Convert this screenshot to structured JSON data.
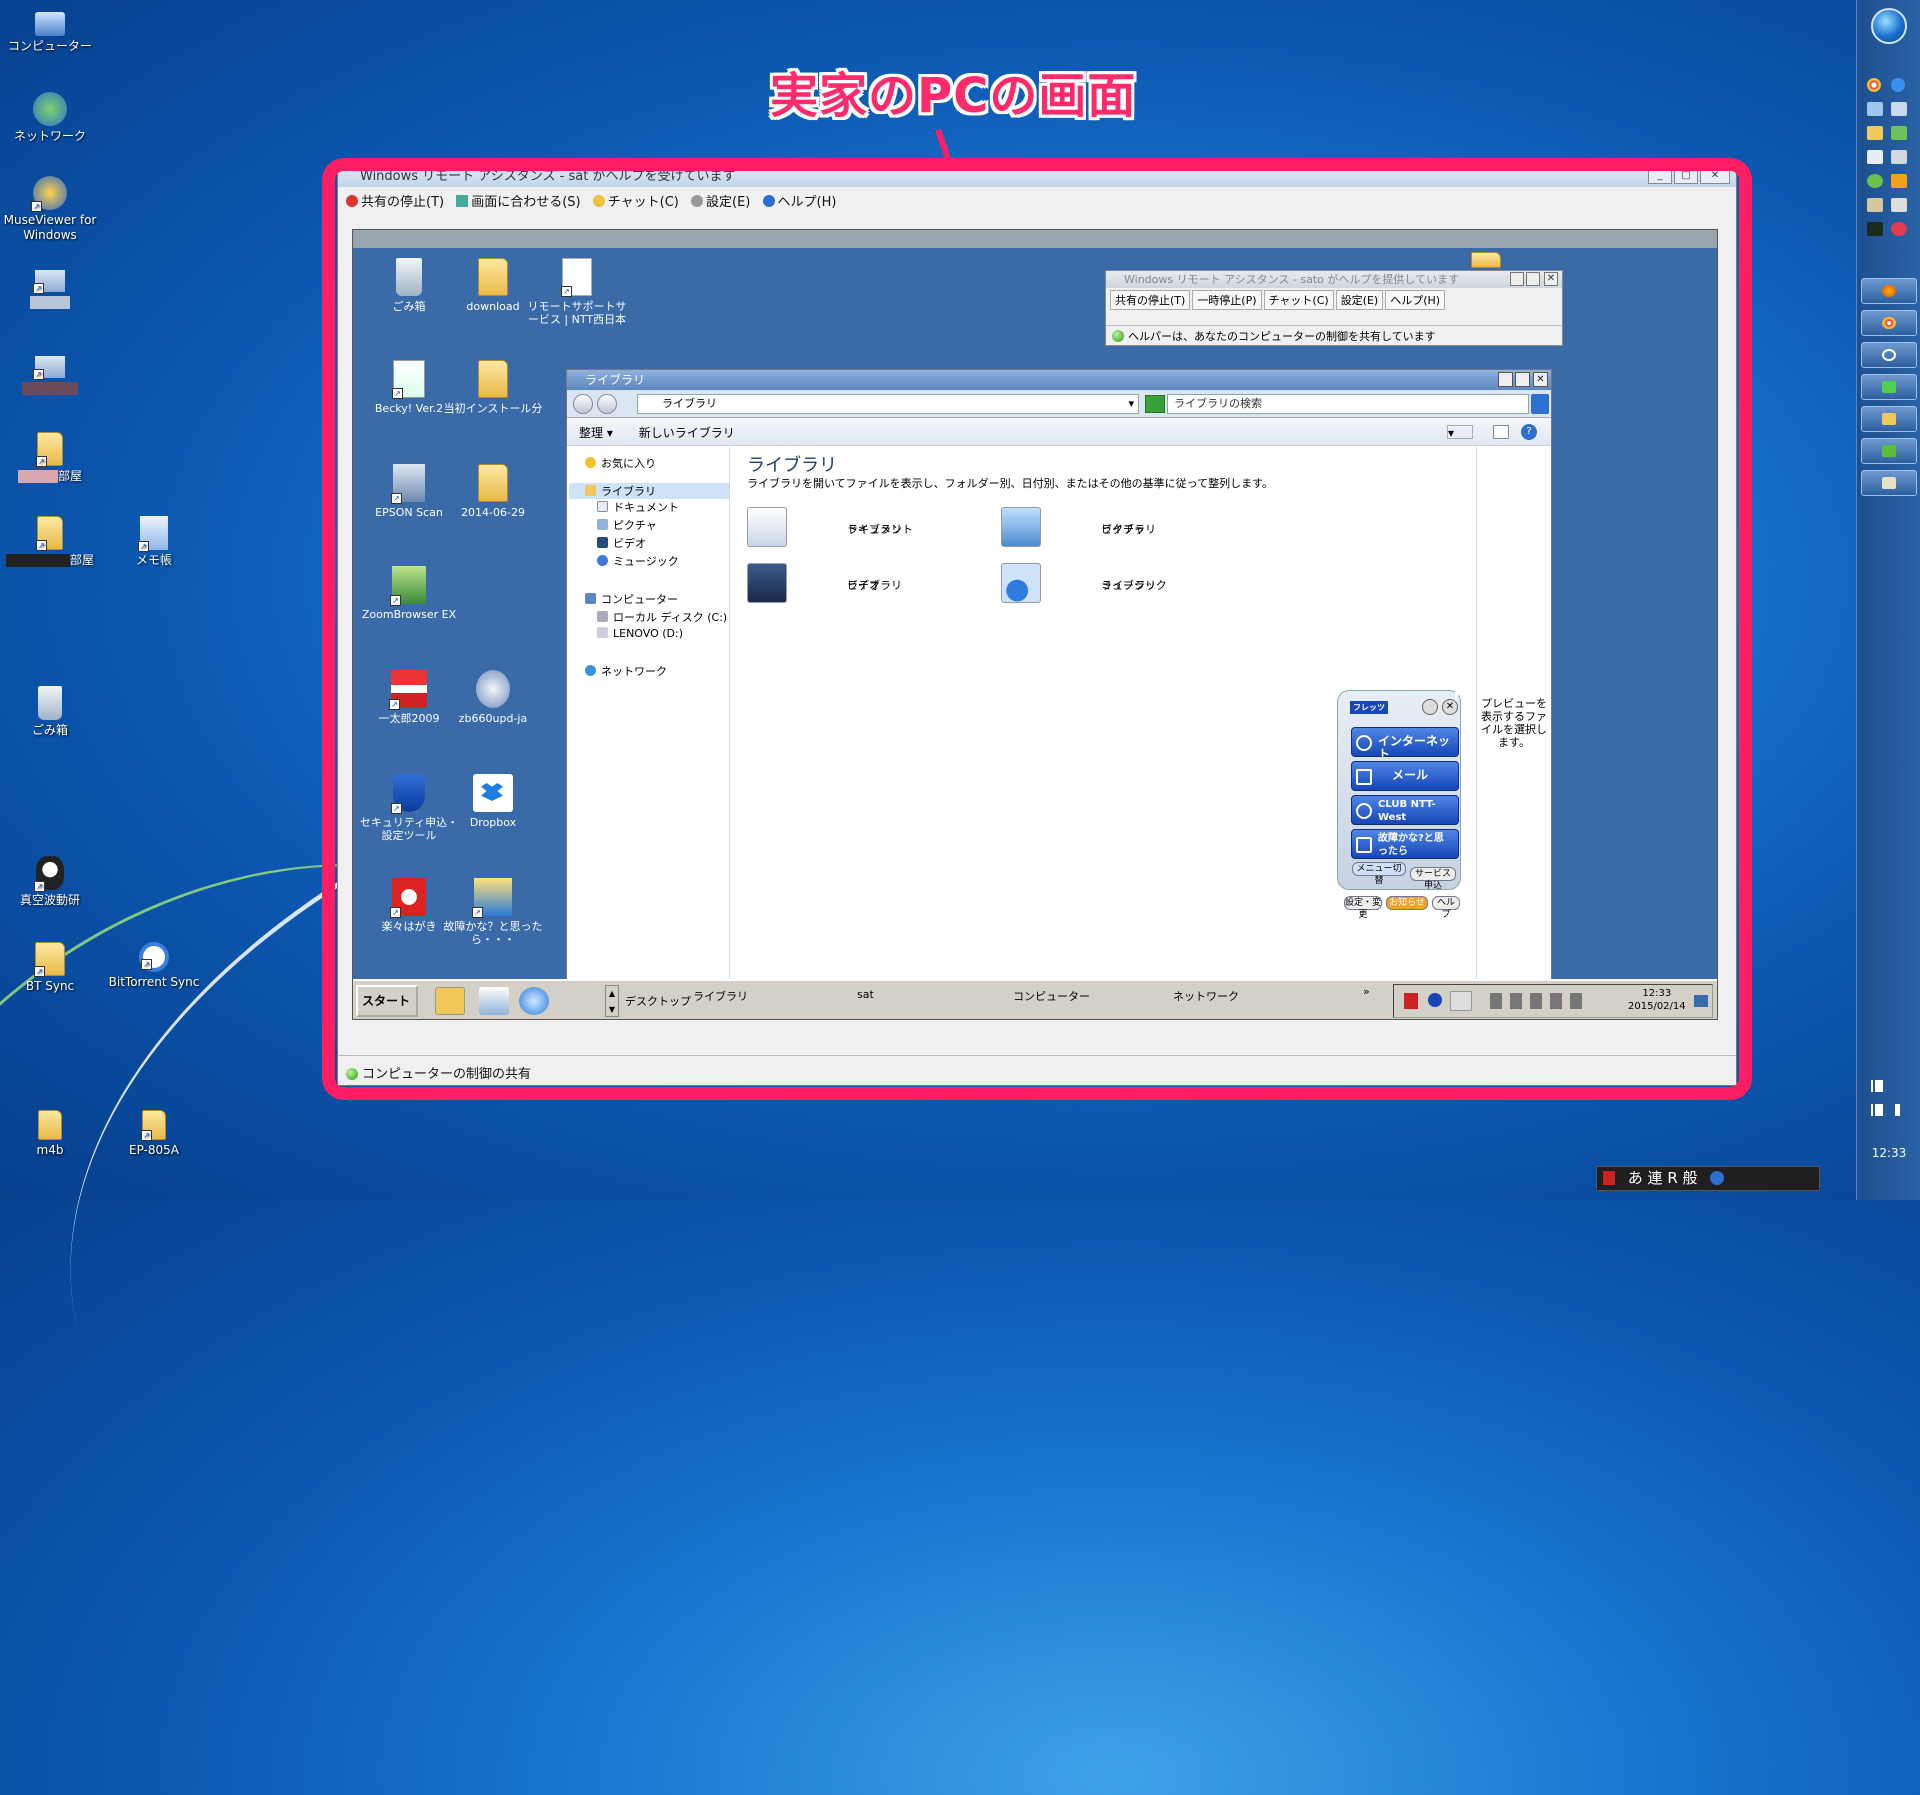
{
  "callout": {
    "text": "実家のPCの画面"
  },
  "desktop": {
    "icons": [
      "コンピューター",
      "ネットワーク",
      "MuseViewer for Windows",
      "部屋",
      "部屋",
      "メモ帳",
      "ごみ箱",
      "真空波動研",
      "BT Sync",
      "BitTorrent Sync",
      "m4b",
      "EP-805A"
    ],
    "clock": "12:33"
  },
  "remote_assistance": {
    "title": "Windows リモート アシスタンス - sat がヘルプを受けています",
    "menu": [
      "共有の停止(T)",
      "画面に合わせる(S)",
      "チャット(C)",
      "設定(E)",
      "ヘルプ(H)"
    ],
    "status": "コンピューターの制御の共有"
  },
  "remote_desktop": {
    "icons": [
      "ごみ箱",
      "download",
      "リモートサポートサービス | NTT西日本",
      "Becky! Ver.2",
      "当初インストール分",
      "EPSON Scan",
      "2014-06-29",
      "ZoomBrowser EX",
      "一太郎2009",
      "zb660upd-ja",
      "セキュリティ申込・設定ツール",
      "Dropbox",
      "楽々はがき",
      "故障かな？と思ったら・・・"
    ],
    "inner_ra": {
      "title": "Windows リモート アシスタンス - sato がヘルプを提供しています",
      "menu": [
        "共有の停止(T)",
        "一時停止(P)",
        "チャット(C)",
        "設定(E)",
        "ヘルプ(H)"
      ],
      "status": "ヘルパーは、あなたのコンピューターの制御を共有しています"
    },
    "library": {
      "title": "ライブラリ",
      "address": "ライブラリ",
      "search_placeholder": "ライブラリの検索",
      "toolbar": [
        "整理",
        "新しいライブラリ"
      ],
      "nav": {
        "favorites": "お気に入り",
        "libraries": "ライブラリ",
        "lib_items": [
          "ドキュメント",
          "ピクチャ",
          "ビデオ",
          "ミュージック"
        ],
        "computer": "コンピューター",
        "drives": [
          "ローカル ディスク (C:)",
          "LENOVO (D:)"
        ],
        "network": "ネットワーク"
      },
      "heading": "ライブラリ",
      "description": "ライブラリを開いてファイルを表示し、フォルダー別、日付別、またはその他の基準に従って整列します。",
      "items": [
        {
          "name": "ドキュメント",
          "sub": "ライブラリ"
        },
        {
          "name": "ピクチャ",
          "sub": "ライブラリ"
        },
        {
          "name": "ビデオ",
          "sub": "ライブラリ"
        },
        {
          "name": "ミュージック",
          "sub": "ライブラリ"
        }
      ],
      "preview": "プレビューを表示するファイルを選択します。"
    },
    "flets": {
      "logo": "フレッツ",
      "buttons": [
        "インターネット",
        "メール",
        "CLUB NTT-West",
        "故障かな?と思ったら"
      ],
      "small": [
        "メニュー切替",
        "サービス申込",
        "設定・変更",
        "お知らせ",
        "ヘルプ"
      ]
    },
    "taskbar": {
      "start": "スタート",
      "items": [
        "デスクトップ",
        "ライブラリ",
        "sat",
        "コンピューター",
        "ネットワーク"
      ],
      "time": "12:33",
      "date": "2015/02/14"
    }
  },
  "language_bar": {
    "text": "あ 連 R 般"
  }
}
